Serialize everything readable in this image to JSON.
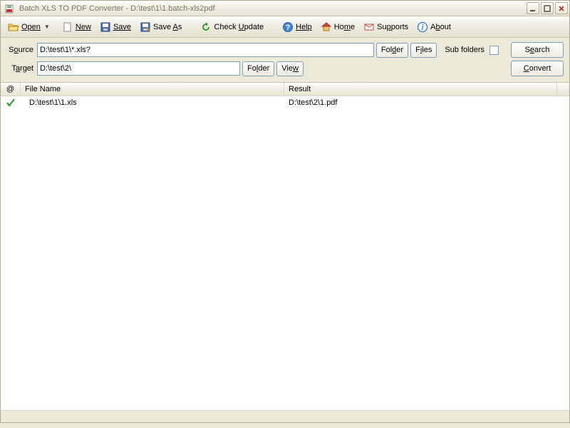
{
  "window": {
    "title": "Batch XLS TO PDF Converter - D:\\test\\1\\1.batch-xls2pdf"
  },
  "toolbar": {
    "open": "Open",
    "new": "New",
    "save": "Save",
    "save_as": "Save As",
    "check_update": "Check Update",
    "help": "Help",
    "home": "Home",
    "supports": "Supports",
    "about": "About"
  },
  "paths": {
    "source_label_pre": "S",
    "source_label_u": "o",
    "source_label_post": "urce",
    "source_value": "D:\\test\\1\\*.xls?",
    "folder_label_pre": "Fol",
    "folder_label_u": "d",
    "folder_label_post": "er",
    "files_label_pre": "F",
    "files_label_u": "i",
    "files_label_post": "les",
    "sub_label_pre": "S",
    "sub_label_u": "u",
    "sub_label_post": "b folders",
    "search_label_pre": "S",
    "search_label_u": "e",
    "search_label_post": "arch",
    "target_label_pre": "T",
    "target_label_u": "a",
    "target_label_post": "rget",
    "target_value": "D:\\test\\2\\",
    "folder2_label_pre": "Fo",
    "folder2_label_u": "l",
    "folder2_label_post": "der",
    "view_label_pre": "Vie",
    "view_label_u": "w",
    "view_label_post": "",
    "convert_label_pre": "",
    "convert_label_u": "C",
    "convert_label_post": "onvert"
  },
  "columns": {
    "at": "@",
    "file_name": "File Name",
    "result": "Result"
  },
  "rows": [
    {
      "status": "ok",
      "file": "D:\\test\\1\\1.xls",
      "result": "D:\\test\\2\\1.pdf"
    }
  ]
}
